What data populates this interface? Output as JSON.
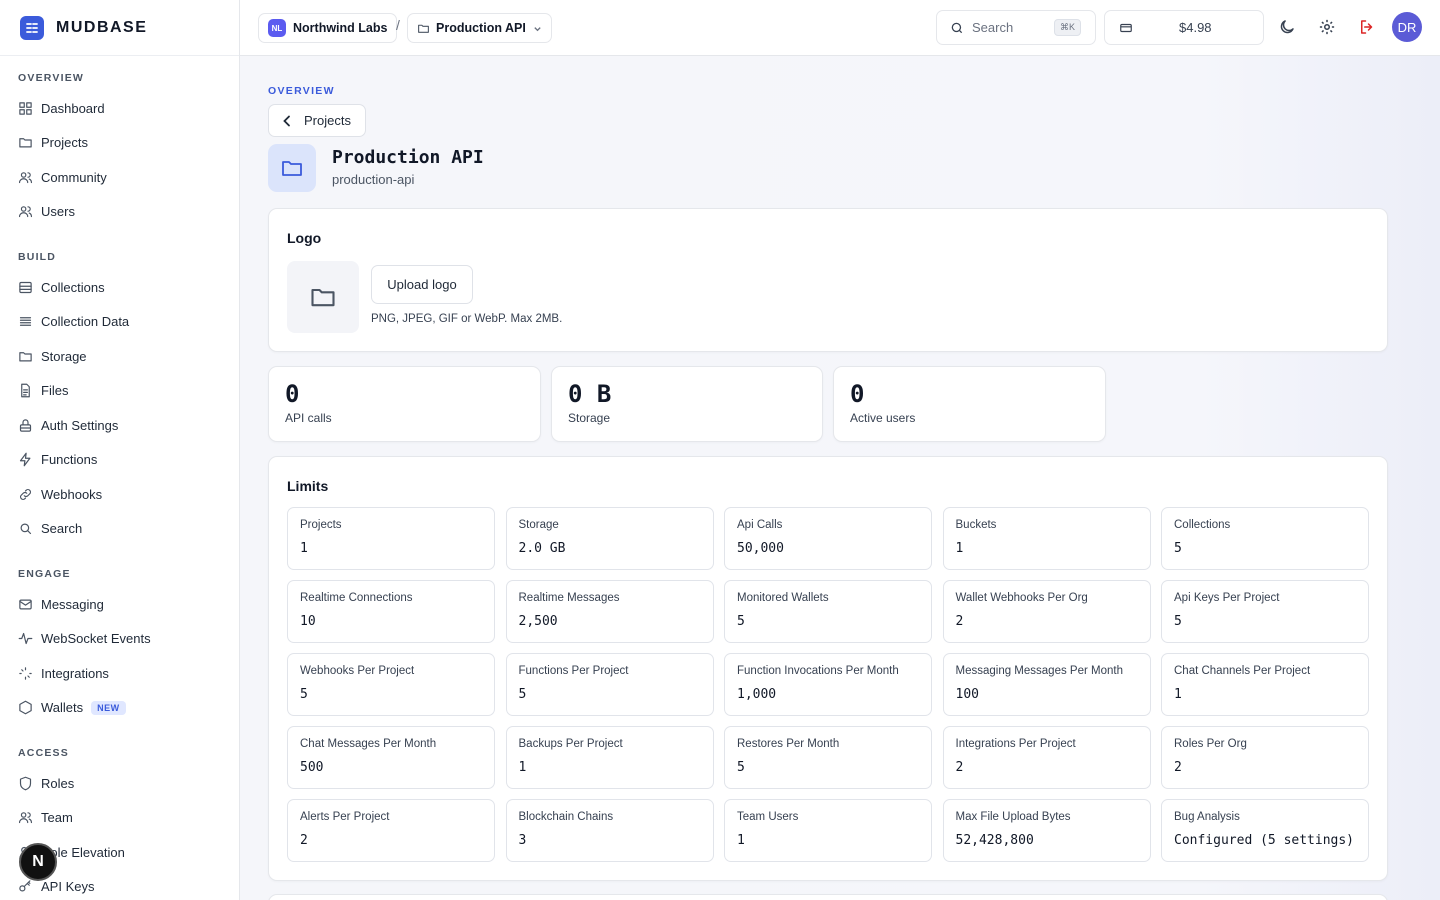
{
  "brand": {
    "name": "MUDBASE"
  },
  "sidebar": {
    "sections": [
      {
        "title": "OVERVIEW",
        "items": [
          {
            "label": "Dashboard",
            "icon": "grid-icon"
          },
          {
            "label": "Projects",
            "icon": "folder-icon"
          },
          {
            "label": "Community",
            "icon": "users-icon"
          },
          {
            "label": "Users",
            "icon": "users-icon"
          }
        ]
      },
      {
        "title": "BUILD",
        "items": [
          {
            "label": "Collections",
            "icon": "database-icon"
          },
          {
            "label": "Collection Data",
            "icon": "list-icon"
          },
          {
            "label": "Storage",
            "icon": "folder-icon"
          },
          {
            "label": "Files",
            "icon": "file-icon"
          },
          {
            "label": "Auth Settings",
            "icon": "lock-icon"
          },
          {
            "label": "Functions",
            "icon": "bolt-icon"
          },
          {
            "label": "Webhooks",
            "icon": "link-icon"
          },
          {
            "label": "Search",
            "icon": "search-icon"
          }
        ]
      },
      {
        "title": "ENGAGE",
        "items": [
          {
            "label": "Messaging",
            "icon": "mail-icon"
          },
          {
            "label": "WebSocket Events",
            "icon": "activity-icon"
          },
          {
            "label": "Integrations",
            "icon": "sparkle-icon"
          },
          {
            "label": "Wallets",
            "icon": "hexagon-icon",
            "badge": "NEW"
          }
        ]
      },
      {
        "title": "ACCESS",
        "items": [
          {
            "label": "Roles",
            "icon": "shield-icon"
          },
          {
            "label": "Team",
            "icon": "users-icon"
          },
          {
            "label": "Role Elevation",
            "icon": "user-up-icon"
          },
          {
            "label": "API Keys",
            "icon": "key-icon"
          }
        ]
      }
    ],
    "floating_badge": "N"
  },
  "topbar": {
    "org": {
      "initials": "NL",
      "name": "Northwind Labs"
    },
    "separator": "/",
    "project": {
      "name": "Production API"
    },
    "search": {
      "placeholder": "Search",
      "shortcut": "⌘K"
    },
    "credits": "$4.98",
    "user_initials": "DR"
  },
  "page": {
    "overline": "OVERVIEW",
    "back_label": "Projects",
    "title": "Production API",
    "slug": "production-api"
  },
  "logo_card": {
    "title": "Logo",
    "upload_label": "Upload logo",
    "hint": "PNG, JPEG, GIF or WebP. Max 2MB."
  },
  "stats": [
    {
      "value": "0",
      "label": "API calls"
    },
    {
      "value": "0 B",
      "label": "Storage"
    },
    {
      "value": "0",
      "label": "Active users"
    }
  ],
  "limits": {
    "title": "Limits",
    "items": [
      {
        "label": "Projects",
        "value": "1"
      },
      {
        "label": "Storage",
        "value": "2.0 GB"
      },
      {
        "label": "Api Calls",
        "value": "50,000"
      },
      {
        "label": "Buckets",
        "value": "1"
      },
      {
        "label": "Collections",
        "value": "5"
      },
      {
        "label": "Realtime Connections",
        "value": "10"
      },
      {
        "label": "Realtime Messages",
        "value": "2,500"
      },
      {
        "label": "Monitored Wallets",
        "value": "5"
      },
      {
        "label": "Wallet Webhooks Per Org",
        "value": "2"
      },
      {
        "label": "Api Keys Per Project",
        "value": "5"
      },
      {
        "label": "Webhooks Per Project",
        "value": "5"
      },
      {
        "label": "Functions Per Project",
        "value": "5"
      },
      {
        "label": "Function Invocations Per Month",
        "value": "1,000"
      },
      {
        "label": "Messaging Messages Per Month",
        "value": "100"
      },
      {
        "label": "Chat Channels Per Project",
        "value": "1"
      },
      {
        "label": "Chat Messages Per Month",
        "value": "500"
      },
      {
        "label": "Backups Per Project",
        "value": "1"
      },
      {
        "label": "Restores Per Month",
        "value": "5"
      },
      {
        "label": "Integrations Per Project",
        "value": "2"
      },
      {
        "label": "Roles Per Org",
        "value": "2"
      },
      {
        "label": "Alerts Per Project",
        "value": "2"
      },
      {
        "label": "Blockchain Chains",
        "value": "3"
      },
      {
        "label": "Team Users",
        "value": "1"
      },
      {
        "label": "Max File Upload Bytes",
        "value": "52,428,800"
      },
      {
        "label": "Bug Analysis",
        "value": "Configured (5 settings)"
      }
    ]
  },
  "colors": {
    "accent": "#3b5bdb",
    "danger": "#dc2626",
    "avatar": "#5b5bd6"
  }
}
